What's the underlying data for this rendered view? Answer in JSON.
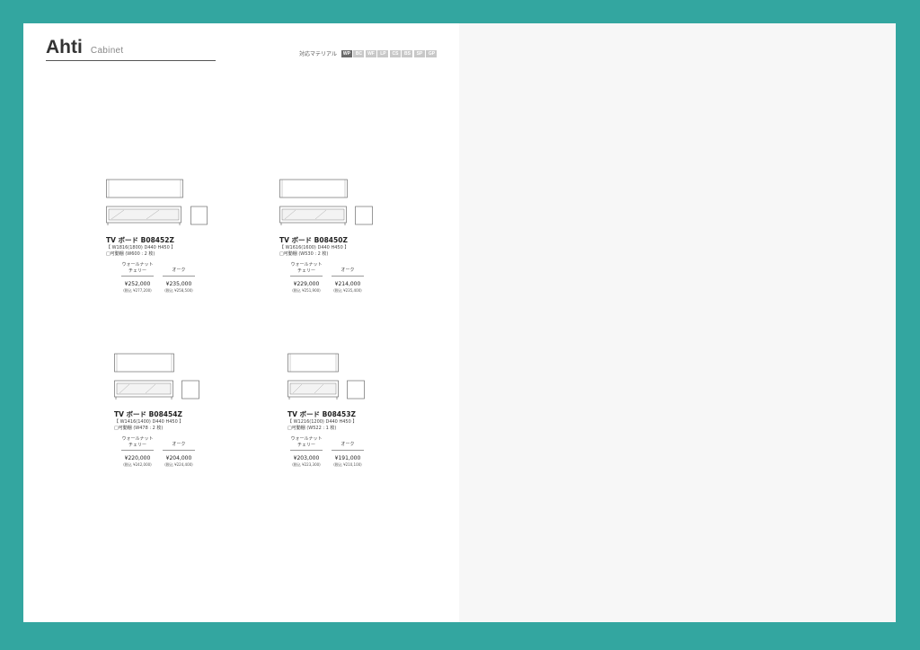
{
  "header": {
    "brand": "Ahti",
    "category": "Cabinet",
    "materials_label": "対応マテリアル",
    "materials": [
      "WP",
      "BC",
      "WF",
      "LP",
      "CS",
      "BS",
      "SP",
      "GP"
    ],
    "active_material": "WP"
  },
  "finish_labels": {
    "walnut_cherry": "ウォールナット\nチェリー",
    "oak": "オーク"
  },
  "products": [
    {
      "name": "TV ボード  B08452Z",
      "spec": "【 W1816(1800)  D440  H450 】",
      "note": "□可動棚 (W600 : 2 枚)",
      "walnut_price": "¥252,000",
      "walnut_incl": "(税込 ¥277,200)",
      "oak_price": "¥235,000",
      "oak_incl": "(税込 ¥258,500)"
    },
    {
      "name": "TV ボード  B08450Z",
      "spec": "【 W1616(1600)  D440  H450 】",
      "note": "□可動棚 (W530 : 2 枚)",
      "walnut_price": "¥229,000",
      "walnut_incl": "(税込 ¥251,900)",
      "oak_price": "¥214,000",
      "oak_incl": "(税込 ¥235,400)"
    },
    {
      "name": "TV ボード  B08454Z",
      "spec": "【 W1416(1400)  D440  H450 】",
      "note": "□可動棚 (W478 : 2 枚)",
      "walnut_price": "¥220,000",
      "walnut_incl": "(税込 ¥242,000)",
      "oak_price": "¥204,000",
      "oak_incl": "(税込 ¥224,400)"
    },
    {
      "name": "TV ボード  B08453Z",
      "spec": "【 W1216(1200)  D440  H450 】",
      "note": "□可動棚 (W522 : 1 枚)",
      "walnut_price": "¥203,000",
      "walnut_incl": "(税込 ¥223,300)",
      "oak_price": "¥191,000",
      "oak_incl": "(税込 ¥210,100)"
    }
  ]
}
